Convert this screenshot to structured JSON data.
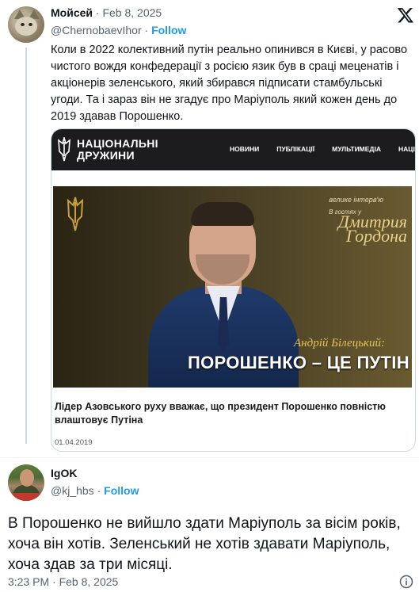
{
  "tweet1": {
    "author_name": "Мойсей",
    "date": "Feb 8, 2025",
    "handle": "@ChernobaevIhor",
    "follow_label": "Follow",
    "text": "Коли в 2022 колективний путін реально опинився в Києві, у расово чистого вождя конфедерації з росією язик був в сраці меценатів і акціонерів зеленського, який збирався підписати стамбульські угоди. Та і зараз він не згадує про Маріуполь який кожен день до 2019 здавав Порошенко.",
    "avatar_icon": "cat-avatar"
  },
  "embed": {
    "site_name_line1": "НАЦІОНАЛЬНІ",
    "site_name_line2": "ДРУЖИНИ",
    "menu": [
      "НОВИНИ",
      "ПУБЛІКАЦІЇ",
      "МУЛЬТИМЕДІА",
      "НАЦІОНА"
    ],
    "banner_tag": "велике інтерв'ю",
    "banner_sub": "В гостях у",
    "banner_show_line1": "Дмитрия",
    "banner_show_line2": "Гордона",
    "speaker": "Андрій Білецький:",
    "headline": "ПОРОШЕНКО – ЦЕ ПУТІН В КИЄВІ",
    "article_title": "Лідер Азовського руху вважає, що президент Порошенко повністю влаштовує Путіна",
    "article_date": "01.04.2019",
    "logo_icon": "trident-icon"
  },
  "tweet2": {
    "author_name": "IgOK",
    "handle": "@kj_hbs",
    "follow_label": "Follow",
    "text": "В Порошенко не вийшло здати Маріуполь за вісім років, хоча він хотів. Зеленський не хотів здавати Маріуполь, хоча здав за три місяці.",
    "time": "3:23 PM",
    "date": "Feb 8, 2025",
    "avatar_icon": "cyclist-avatar"
  },
  "colors": {
    "accent": "#1d9bf0",
    "text": "#0f1419",
    "muted": "#536471",
    "nav_bg": "#1c1c1e"
  }
}
